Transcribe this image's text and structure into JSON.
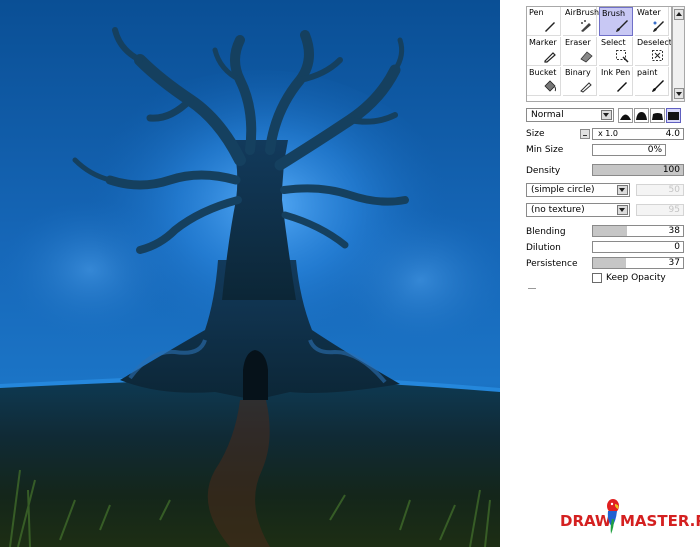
{
  "tools": [
    {
      "label": "Pen",
      "icon": "pen-icon"
    },
    {
      "label": "AirBrush",
      "icon": "airbrush-icon"
    },
    {
      "label": "Brush",
      "icon": "brush-icon",
      "selected": true
    },
    {
      "label": "Water",
      "icon": "water-brush-icon"
    },
    {
      "label": "Marker",
      "icon": "marker-icon"
    },
    {
      "label": "Eraser",
      "icon": "eraser-icon"
    },
    {
      "label": "Select",
      "icon": "select-icon"
    },
    {
      "label": "Deselect",
      "icon": "deselect-icon"
    },
    {
      "label": "Bucket",
      "icon": "bucket-icon"
    },
    {
      "label": "Binary",
      "icon": "binary-pen-icon"
    },
    {
      "label": "Ink Pen",
      "icon": "ink-pen-icon"
    },
    {
      "label": "paint",
      "icon": "paint-brush-icon"
    }
  ],
  "blend_mode": "Normal",
  "brush_shapes": [
    "soft-shape-icon",
    "medium-shape-icon",
    "hard-shape-icon",
    "square-shape-icon"
  ],
  "size": {
    "label": "Size",
    "multiplier": "x 1.0",
    "value": "4.0"
  },
  "min_size": {
    "label": "Min Size",
    "value": "0%",
    "level": 0.0
  },
  "density": {
    "label": "Density",
    "value": "100",
    "level": 1.0
  },
  "shape_select": {
    "value": "(simple circle)",
    "amount": "50"
  },
  "texture_select": {
    "value": "(no texture)",
    "amount": "95"
  },
  "blending": {
    "label": "Blending",
    "value": "38",
    "level": 0.38
  },
  "dilution": {
    "label": "Dilution",
    "value": "0",
    "level": 0.0
  },
  "persistence": {
    "label": "Persistence",
    "value": "37",
    "level": 0.37
  },
  "keep_opacity": {
    "label": "Keep Opacity",
    "checked": false
  },
  "watermark": {
    "part1": "DRAW",
    "part2": "MASTER.RU"
  },
  "colors": {
    "selected_tool": "#c8c8f4",
    "slider_fill": "#c6c6c6",
    "watermark": "#d42020"
  }
}
